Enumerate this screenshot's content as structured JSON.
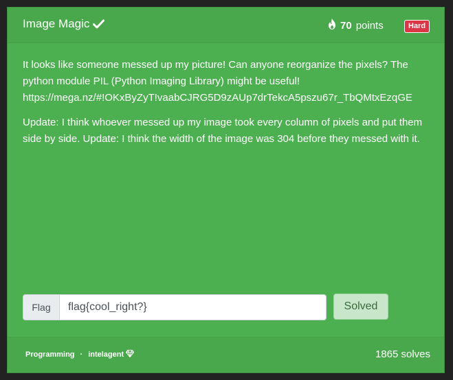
{
  "challenge": {
    "title": "Image Magic",
    "points": "70",
    "points_label": "points",
    "difficulty": "Hard"
  },
  "description": {
    "paragraph1": "It looks like someone messed up my picture! Can anyone reorganize the pixels? The python module PIL (Python Imaging Library) might be useful! https://mega.nz/#!OKxByZyT!vaabCJRG5D9zAUp7drTekcA5pszu67r_TbQMtxEzqGE",
    "paragraph2": "Update: I think whoever messed up my image took every column of pixels and put them side by side. Update: I think the width of the image was 304 before they messed with it."
  },
  "flag_form": {
    "label": "Flag",
    "value": "flag{cool_right?}",
    "submit_label": "Solved"
  },
  "footer": {
    "category": "Programming",
    "separator": "·",
    "author": "intelagent",
    "solves": "1865 solves"
  },
  "colors": {
    "card": "#4caf50",
    "badge": "#dc3545",
    "background": "#222222"
  },
  "icons": {
    "title": "check-icon",
    "points": "fire-icon",
    "author": "gem-icon"
  }
}
